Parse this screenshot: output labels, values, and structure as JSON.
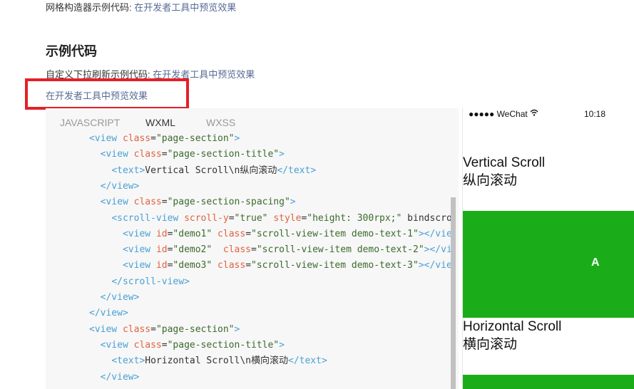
{
  "top": {
    "grid_label": "网格构造器示例代码: ",
    "grid_link": "在开发者工具中预览效果",
    "heading": "示例代码",
    "refresh_label": "自定义下拉刷新示例代码: ",
    "refresh_link": "在开发者工具中预览效果",
    "preview_link": "在开发者工具中预览效果"
  },
  "tabs": [
    "JAVASCRIPT",
    "WXML",
    "WXSS"
  ],
  "active_tab": "WXML",
  "code_lines": [
    "<view class=\"page-section\">",
    "  <view class=\"page-section-title\">",
    "    <text>Vertical Scroll\\n纵向滚动</text>",
    "  </view>",
    "  <view class=\"page-section-spacing\">",
    "    <scroll-view scroll-y=\"true\" style=\"height: 300rpx;\" bindscrol",
    "      <view id=\"demo1\" class=\"scroll-view-item demo-text-1\"></view",
    "      <view id=\"demo2\"  class=\"scroll-view-item demo-text-2\"></vie",
    "      <view id=\"demo3\" class=\"scroll-view-item demo-text-3\"></view",
    "    </scroll-view>",
    "  </view>",
    "</view>",
    "<view class=\"page-section\">",
    "  <view class=\"page-section-title\">",
    "    <text>Horizontal Scroll\\n横向滚动</text>",
    "  </view>"
  ],
  "phone": {
    "carrier": "●●●●● WeChat",
    "wifi_icon": "wifi-icon",
    "time": "10:18",
    "vertical_title": "Vertical Scroll",
    "vertical_subtitle": "纵向滚动",
    "block_label": "A",
    "horizontal_title": "Horizontal Scroll",
    "horizontal_subtitle": "横向滚动",
    "block_color": "#1aad19"
  },
  "colors": {
    "highlight_box": "#e4202a",
    "link": "#576b95",
    "code_tag": "#4aa0d5",
    "code_attr": "#e0623f",
    "code_string": "#3c6a2d"
  }
}
